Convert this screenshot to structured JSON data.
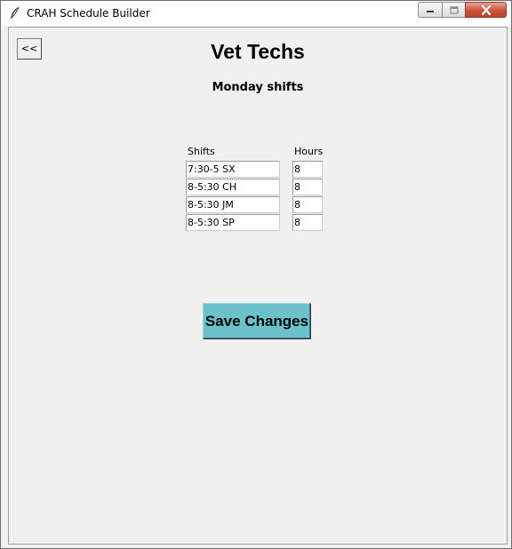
{
  "window": {
    "title": "CRAH Schedule Builder"
  },
  "nav": {
    "back_label": "<<"
  },
  "page": {
    "title": "Vet Techs",
    "subtitle": "Monday shifts"
  },
  "table": {
    "shifts_header": "Shifts",
    "hours_header": "Hours",
    "rows": [
      {
        "shift": "7:30-5 SX",
        "hours": "8"
      },
      {
        "shift": "8-5:30 CH",
        "hours": "8"
      },
      {
        "shift": "8-5:30 JM",
        "hours": "8"
      },
      {
        "shift": "8-5:30 SP",
        "hours": "8"
      }
    ]
  },
  "actions": {
    "save_label": "Save Changes"
  },
  "colors": {
    "save_button_bg": "#6cc2cc",
    "window_bg": "#f0f0f0",
    "close_button": "#c9523a"
  }
}
